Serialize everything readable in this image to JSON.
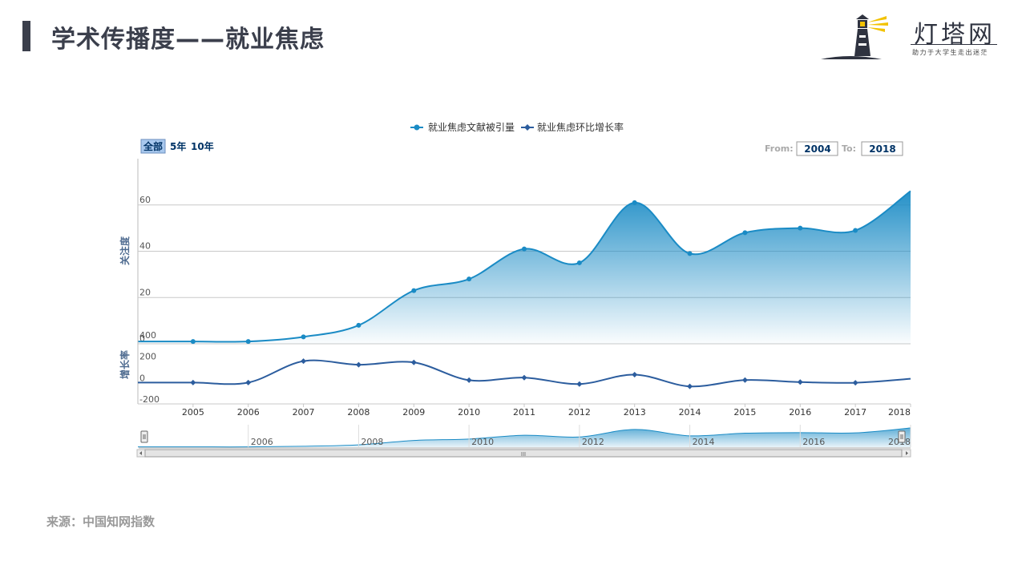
{
  "header": {
    "title": "学术传播度——就业焦虑"
  },
  "logo": {
    "name": "灯塔网",
    "slogan": "助力于大学生走出迷茫"
  },
  "footer": {
    "source": "来源：中国知网指数"
  },
  "range_selector": {
    "buttons": [
      "全部",
      "5年",
      "10年"
    ],
    "selected": "全部",
    "from_label": "From:",
    "from_value": "2004",
    "to_label": "To:",
    "to_value": "2018"
  },
  "colors": {
    "series1": "#1a8bc5",
    "series2": "#2c5d9e",
    "title": "#3b3f4c",
    "button_active": "#a8c8ee"
  },
  "chart_data": [
    {
      "type": "area",
      "x": [
        2004,
        2005,
        2006,
        2007,
        2008,
        2009,
        2010,
        2011,
        2012,
        2013,
        2014,
        2015,
        2016,
        2017,
        2018
      ],
      "series": [
        {
          "name": "就业焦虑文献被引量",
          "values": [
            1,
            1,
            1,
            3,
            8,
            23,
            28,
            41,
            35,
            61,
            39,
            48,
            50,
            49,
            66
          ]
        }
      ],
      "ylabel": "关注度",
      "yticks": [
        0,
        20,
        40,
        60
      ],
      "ylim": [
        0,
        80
      ],
      "legend": "top-center",
      "grid": true
    },
    {
      "type": "line",
      "x": [
        2004,
        2005,
        2006,
        2007,
        2008,
        2009,
        2010,
        2011,
        2012,
        2013,
        2014,
        2015,
        2016,
        2017,
        2018
      ],
      "series": [
        {
          "name": "就业焦虑环比增长率",
          "values": [
            0,
            0,
            0,
            200,
            167,
            188,
            22,
            46,
            -14,
            74,
            -36,
            23,
            4,
            -2,
            35
          ]
        }
      ],
      "ylabel": "增长率",
      "yticks": [
        -200,
        0,
        200,
        400
      ],
      "ylim": [
        -200,
        400
      ],
      "xticks": [
        2005,
        2006,
        2007,
        2008,
        2009,
        2010,
        2011,
        2012,
        2013,
        2014,
        2015,
        2016,
        2017,
        2018
      ]
    }
  ],
  "navigator": {
    "labels": [
      "2006",
      "2008",
      "2010",
      "2012",
      "2014",
      "2016",
      "2018"
    ],
    "scroll_grip": "III"
  }
}
